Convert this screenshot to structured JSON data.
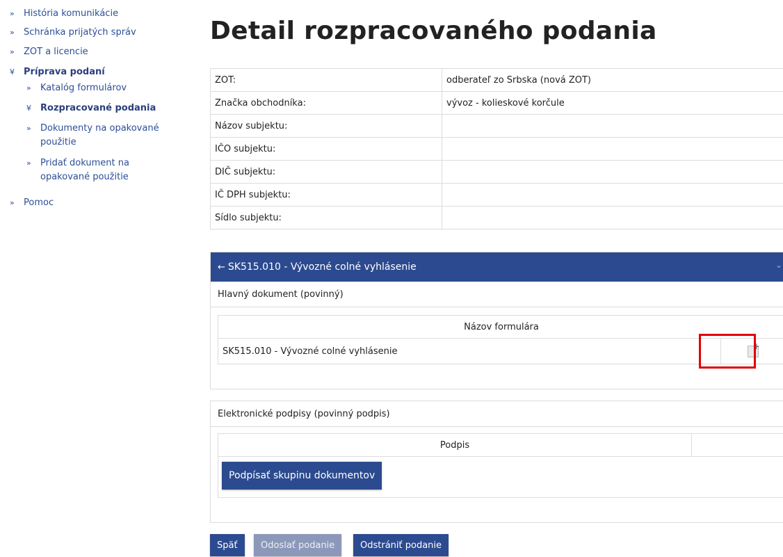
{
  "sidebar": {
    "items": [
      {
        "label": "História komunikácie",
        "marker": "»"
      },
      {
        "label": "Schránka prijatých správ",
        "marker": "»"
      },
      {
        "label": "ZOT a licencie",
        "marker": "»"
      },
      {
        "label": "Príprava podaní",
        "marker": "¥"
      },
      {
        "label": "Katalóg formulárov",
        "marker": "»"
      },
      {
        "label": "Rozpracované podania",
        "marker": "¥"
      },
      {
        "label": "Dokumenty na opakované",
        "label2": "použitie",
        "marker": "»"
      },
      {
        "label": "Pridať dokument na",
        "label2": "opakované použitie",
        "marker": "»"
      },
      {
        "label": "Pomoc",
        "marker": "»"
      }
    ]
  },
  "main": {
    "title": "Detail rozpracovaného podania",
    "info": [
      {
        "key": "ZOT:",
        "value": "odberateľ zo Srbska (nová ZOT)"
      },
      {
        "key": "Značka obchodníka:",
        "value": "vývoz - kolieskové korčule"
      },
      {
        "key": "Názov subjektu:",
        "value": ""
      },
      {
        "key": "IČO subjektu:",
        "value": ""
      },
      {
        "key": "DIČ subjektu:",
        "value": ""
      },
      {
        "key": "IČ DPH subjektu:",
        "value": ""
      },
      {
        "key": "Sídlo subjektu:",
        "value": ""
      }
    ],
    "form_panel": {
      "header": "SK515.010 - Vývozné colné vyhlásenie",
      "arrow": "←",
      "chevron": "⌄",
      "subtitle": "Hlavný dokument (povinný)",
      "column": "Názov formulára",
      "row_label": "SK515.010 - Vývozné colné vyhlásenie",
      "row_icon": "add-document-icon"
    },
    "signature_panel": {
      "subtitle": "Elektronické podpisy (povinný podpis)",
      "column": "Podpis",
      "sign_button": "Podpísať skupinu dokumentov"
    },
    "buttons": {
      "back": "Späť",
      "send": "Odoslať podanie",
      "delete": "Odstrániť podanie"
    }
  },
  "colors": {
    "accent": "#2c4a8f",
    "link": "#2b4e98",
    "highlight": "#e00000",
    "disabled": "#8b98b9"
  }
}
